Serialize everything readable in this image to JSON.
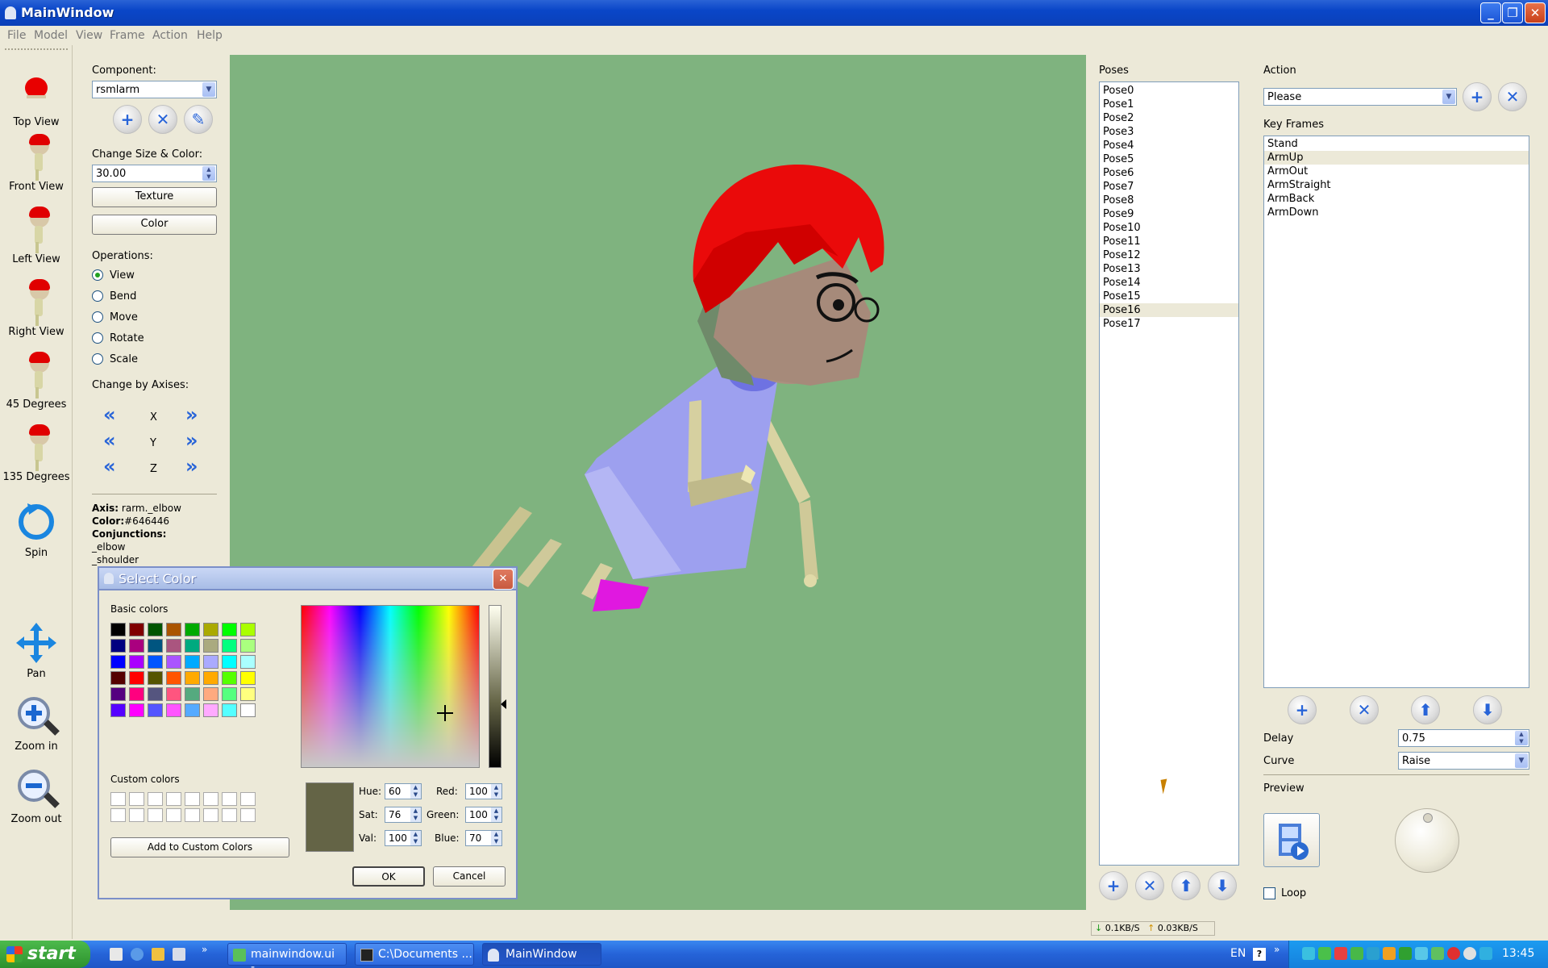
{
  "window": {
    "title": "MainWindow"
  },
  "menu": [
    "File",
    "Model",
    "View",
    "Frame",
    "Action",
    "Help"
  ],
  "view_tools": [
    {
      "label": "Top View",
      "icon": "top-view-icon"
    },
    {
      "label": "Front View",
      "icon": "front-view-icon"
    },
    {
      "label": "Left View",
      "icon": "left-view-icon"
    },
    {
      "label": "Right View",
      "icon": "right-view-icon"
    },
    {
      "label": "45 Degrees",
      "icon": "45-degrees-icon"
    },
    {
      "label": "135 Degrees",
      "icon": "135-degrees-icon"
    },
    {
      "label": "Spin",
      "icon": "spin-icon"
    },
    {
      "label": "Pan",
      "icon": "pan-icon"
    },
    {
      "label": "Zoom in",
      "icon": "zoom-in-icon"
    },
    {
      "label": "Zoom out",
      "icon": "zoom-out-icon"
    }
  ],
  "component": {
    "label": "Component:",
    "value": "rsmlarm",
    "size_color_label": "Change Size & Color:",
    "size_value": "30.00",
    "texture_button": "Texture",
    "color_button": "Color",
    "operations_label": "Operations:",
    "operations": [
      "View",
      "Bend",
      "Move",
      "Rotate",
      "Scale"
    ],
    "selected_operation": "View",
    "axes_label": "Change by Axises:",
    "axes": [
      "X",
      "Y",
      "Z"
    ],
    "info": {
      "axis_label": "Axis:",
      "axis_value": "rarm._elbow",
      "color_label": "Color:",
      "color_value": "#646446",
      "conj_label": "Conjunctions:",
      "conj": [
        "_elbow",
        "_shoulder"
      ]
    }
  },
  "poses": {
    "label": "Poses",
    "items": [
      "Pose0",
      "Pose1",
      "Pose2",
      "Pose3",
      "Pose4",
      "Pose5",
      "Pose6",
      "Pose7",
      "Pose8",
      "Pose9",
      "Pose10",
      "Pose11",
      "Pose12",
      "Pose13",
      "Pose14",
      "Pose15",
      "Pose16",
      "Pose17"
    ],
    "selected": "Pose16"
  },
  "action": {
    "label": "Action",
    "value": "Please",
    "keyframes_label": "Key Frames",
    "keyframes": [
      "Stand",
      "ArmUp",
      "ArmOut",
      "ArmStraight",
      "ArmBack",
      "ArmDown"
    ],
    "selected_keyframe": "ArmUp",
    "delay_label": "Delay",
    "delay_value": "0.75",
    "curve_label": "Curve",
    "curve_value": "Raise",
    "preview_label": "Preview",
    "loop_label": "Loop"
  },
  "color_dialog": {
    "title": "Select Color",
    "basic_label": "Basic colors",
    "basic_colors": [
      "#000000",
      "#800000",
      "#005500",
      "#aa5500",
      "#00aa00",
      "#aaaa00",
      "#00ff00",
      "#aaff00",
      "#000080",
      "#aa007f",
      "#005580",
      "#aa557f",
      "#00aa7f",
      "#aaaa7f",
      "#00ff7f",
      "#aaff7f",
      "#0000ff",
      "#aa00ff",
      "#0055ff",
      "#aa55ff",
      "#00aaff",
      "#aaaaff",
      "#00ffff",
      "#aaffff",
      "#550000",
      "#ff0000",
      "#555500",
      "#ff5500",
      "#ffaa00",
      "#ffaa00",
      "#55ff00",
      "#ffff00",
      "#550080",
      "#ff007f",
      "#55557f",
      "#ff557f",
      "#55aa7f",
      "#ffaa7f",
      "#55ff7f",
      "#ffff7f",
      "#5500ff",
      "#ff00ff",
      "#5555ff",
      "#ff55ff",
      "#55aaff",
      "#ffaaff",
      "#55ffff",
      "#ffffff"
    ],
    "custom_label": "Custom colors",
    "add_custom_button": "Add to Custom Colors",
    "current_color": "#646446",
    "hue_label": "Hue:",
    "hue": "60",
    "sat_label": "Sat:",
    "sat": "76",
    "val_label": "Val:",
    "val": "100",
    "red_label": "Red:",
    "red": "100",
    "green_label": "Green:",
    "green": "100",
    "blue_label": "Blue:",
    "blue": "70",
    "ok_button": "OK",
    "cancel_button": "Cancel"
  },
  "status": {
    "down": "0.1KB/S",
    "up": "0.03KB/S"
  },
  "taskbar": {
    "start": "start",
    "tasks": [
      "mainwindow.ui -...",
      "C:\\Documents ...",
      "MainWindow"
    ],
    "lang": "EN",
    "time": "13:45"
  }
}
